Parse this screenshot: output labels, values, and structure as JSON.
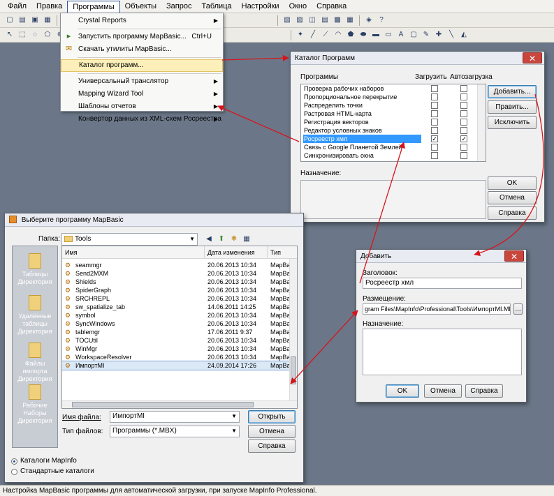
{
  "menubar": {
    "items": [
      "Файл",
      "Правка",
      "Программы",
      "Объекты",
      "Запрос",
      "Таблица",
      "Настройки",
      "Окно",
      "Справка"
    ],
    "active_index": 2
  },
  "toolbar_icons": [
    "new-icon",
    "open-icon",
    "save-icon",
    "print-icon",
    "cut-icon",
    "copy-icon",
    "paste-icon",
    "undo-icon",
    "select-icon",
    "zoom-icon",
    "info-icon",
    "layer-icon",
    "line-icon",
    "polygon-icon",
    "text-icon"
  ],
  "programs_menu": {
    "items": [
      {
        "label": "Crystal Reports",
        "submenu": true
      },
      {
        "label": "Запустить программу MapBasic...",
        "shortcut": "Ctrl+U",
        "icon": "run-program-icon"
      },
      {
        "label": "Скачать утилиты MapBasic...",
        "icon": "download-icon"
      },
      {
        "label": "Каталог программ...",
        "highlighted": true
      },
      {
        "label": "Универсальный транслятор",
        "submenu": true
      },
      {
        "label": "Mapping Wizard Tool",
        "submenu": true
      },
      {
        "label": "Шаблоны отчетов",
        "submenu": true
      },
      {
        "label": "Конвертор данных из XML-схем Росреестра",
        "submenu": true
      }
    ]
  },
  "catalog_dialog": {
    "title": "Каталог Программ",
    "close_label": "✕",
    "col_programs": "Программы",
    "col_load": "Загрузить",
    "col_autoload": "Автозагрузка",
    "items": [
      {
        "name": "Проверка рабочих наборов",
        "load": false,
        "autoload": false
      },
      {
        "name": "Пропорциональное перекрытие",
        "load": false,
        "autoload": false
      },
      {
        "name": "Распределить точки",
        "load": false,
        "autoload": false
      },
      {
        "name": "Растровая HTML-карта",
        "load": false,
        "autoload": false
      },
      {
        "name": "Регистрация векторов",
        "load": false,
        "autoload": false
      },
      {
        "name": "Редактор условных знаков",
        "load": false,
        "autoload": false
      },
      {
        "name": "Росреестр хмл",
        "load": true,
        "autoload": true,
        "selected": true
      },
      {
        "name": "Связь с Google Планетой Землей",
        "load": false,
        "autoload": false
      },
      {
        "name": "Синхронизировать окна",
        "load": false,
        "autoload": false
      }
    ],
    "purpose_label": "Назначение:",
    "buttons": {
      "add": "Добавить...",
      "edit": "Править...",
      "exclude": "Исключить",
      "ok": "OK",
      "cancel": "Отмена",
      "help": "Справка"
    }
  },
  "file_dialog": {
    "title": "Выберите программу MapBasic",
    "folder_label": "Папка:",
    "folder_value": "Tools",
    "places": [
      "Таблицы Директория",
      "Удалённые таблицы Директория",
      "Файлы импорта Директория",
      "Рабочие Наборы Директория"
    ],
    "columns": {
      "name": "Имя",
      "date": "Дата изменения",
      "type": "Тип"
    },
    "files": [
      {
        "name": "seammgr",
        "date": "20.06.2013 10:34",
        "type": "MapBa"
      },
      {
        "name": "Send2MXM",
        "date": "20.06.2013 10:34",
        "type": "MapBa"
      },
      {
        "name": "Shields",
        "date": "20.06.2013 10:34",
        "type": "MapBa"
      },
      {
        "name": "SpiderGraph",
        "date": "20.06.2013 10:34",
        "type": "MapBa"
      },
      {
        "name": "SRCHREPL",
        "date": "20.06.2013 10:34",
        "type": "MapBa"
      },
      {
        "name": "sw_spatialize_tab",
        "date": "14.06.2011 14:25",
        "type": "MapBa"
      },
      {
        "name": "symbol",
        "date": "20.06.2013 10:34",
        "type": "MapBa"
      },
      {
        "name": "SyncWindows",
        "date": "20.06.2013 10:34",
        "type": "MapBa"
      },
      {
        "name": "tablemgr",
        "date": "17.06.2011 9:37",
        "type": "MapBa"
      },
      {
        "name": "TOCUtil",
        "date": "20.06.2013 10:34",
        "type": "MapBa"
      },
      {
        "name": "WinMgr",
        "date": "20.06.2013 10:34",
        "type": "MapBa"
      },
      {
        "name": "WorkspaceResolver",
        "date": "20.06.2013 10:34",
        "type": "MapBa"
      },
      {
        "name": "ИмпортMI",
        "date": "24.09.2014 17:26",
        "type": "MapBa",
        "selected": true
      }
    ],
    "filename_label": "Имя файла:",
    "filename_value": "ИмпортMI",
    "filetype_label": "Тип файлов:",
    "filetype_value": "Программы (*.MBX)",
    "buttons": {
      "open": "Открыть",
      "cancel": "Отмена",
      "help": "Справка"
    },
    "radios": [
      {
        "label": "Каталоги MapInfo",
        "checked": true
      },
      {
        "label": "Стандартные каталоги",
        "checked": false
      }
    ]
  },
  "add_dialog": {
    "title": "Добавить",
    "close_label": "✕",
    "heading_label": "Заголовок:",
    "heading_value": "Росреестр хмл",
    "location_label": "Размещение:",
    "location_value": "gram Files\\MapInfo\\Professional\\Tools\\ИмпортMI.MBX",
    "browse_label": "...",
    "purpose_label": "Назначение:",
    "buttons": {
      "ok": "OK",
      "cancel": "Отмена",
      "help": "Справка"
    }
  },
  "statusbar": {
    "text": "Настройка MapBasic программы для автоматической загрузки, при запуске MapInfo Professional."
  },
  "colors": {
    "workspace": "#6b7788",
    "arrow": "#d7141b",
    "selection": "#3399ff",
    "menu_highlight": "#fcefb9"
  }
}
